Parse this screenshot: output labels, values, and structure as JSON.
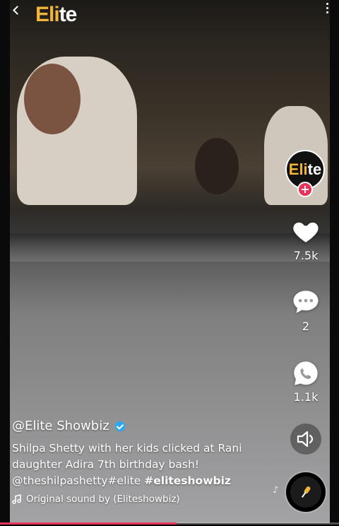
{
  "header": {
    "logo_text_a": "Eli",
    "logo_text_b": "te"
  },
  "actions": {
    "avatar_text_a": "Eli",
    "avatar_text_b": "te",
    "follow_symbol": "+",
    "likes": "7.5k",
    "comments": "2",
    "shares": "1.1k"
  },
  "caption": {
    "username": "@Elite Showbiz",
    "description": "Shilpa Shetty with her kids clicked at Rani daughter Adira 7th birthday bash!",
    "mention_line": "@theshilpashetty#elite",
    "hashtag": "#eliteshowbiz",
    "sound": "Original sound by (Eliteshowbiz)"
  },
  "playback": {
    "progress": 0.52
  },
  "colors": {
    "brand_gold": "#f2b53a",
    "accent_pink": "#e8315b",
    "verified_blue": "#28a9f0"
  },
  "icons": [
    "back-icon",
    "more-icon",
    "heart-icon",
    "comment-icon",
    "whatsapp-icon",
    "speaker-icon",
    "music-note-icon",
    "mic-icon"
  ]
}
